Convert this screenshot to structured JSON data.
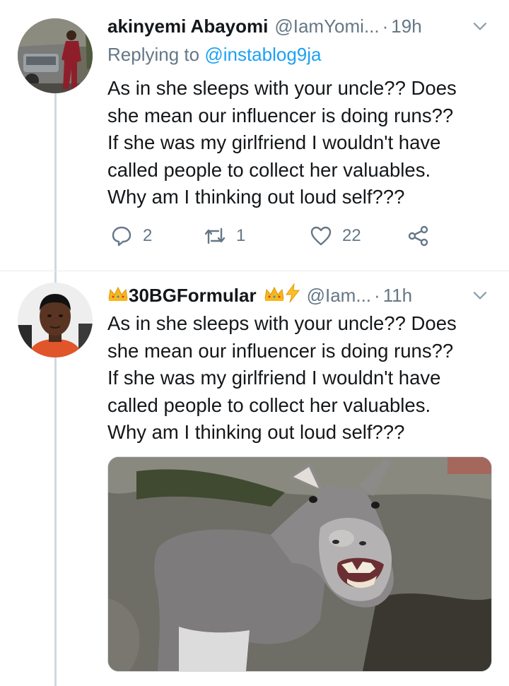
{
  "tweets": [
    {
      "display_name": "akinyemi Abayomi",
      "handle": "@IamYomi...",
      "separator": "·",
      "time": "19h",
      "replying_prefix": "Replying to",
      "replying_to": "@instablog9ja",
      "text": "As in she sleeps with your uncle?? Does\nshe mean our influencer is doing runs??\nIf she was my girlfriend I wouldn't have\ncalled people to collect her valuables.\nWhy am I thinking out loud self???",
      "stats": {
        "replies": "2",
        "retweets": "1",
        "likes": "22"
      }
    },
    {
      "display_name": "30BGFormular",
      "handle": "@Iam...",
      "separator": "·",
      "time": "11h",
      "text": "As in she sleeps with your uncle?? Does\nshe mean our influencer is doing runs??\nIf she was my girlfriend I wouldn't have\ncalled people to collect her valuables.\nWhy am I thinking out loud self???",
      "media": {
        "subject": "laughing donkey photo"
      }
    }
  ],
  "icons": {
    "reply": "reply-icon",
    "retweet": "retweet-icon",
    "like": "heart-icon",
    "share": "share-icon",
    "more": "chevron-down-icon",
    "crown": "crown-emoji",
    "lightning": "lightning-emoji"
  },
  "colors": {
    "link": "#1da1f2",
    "secondary": "#657786",
    "thread_line": "#cfd9de",
    "text": "#14171a"
  }
}
